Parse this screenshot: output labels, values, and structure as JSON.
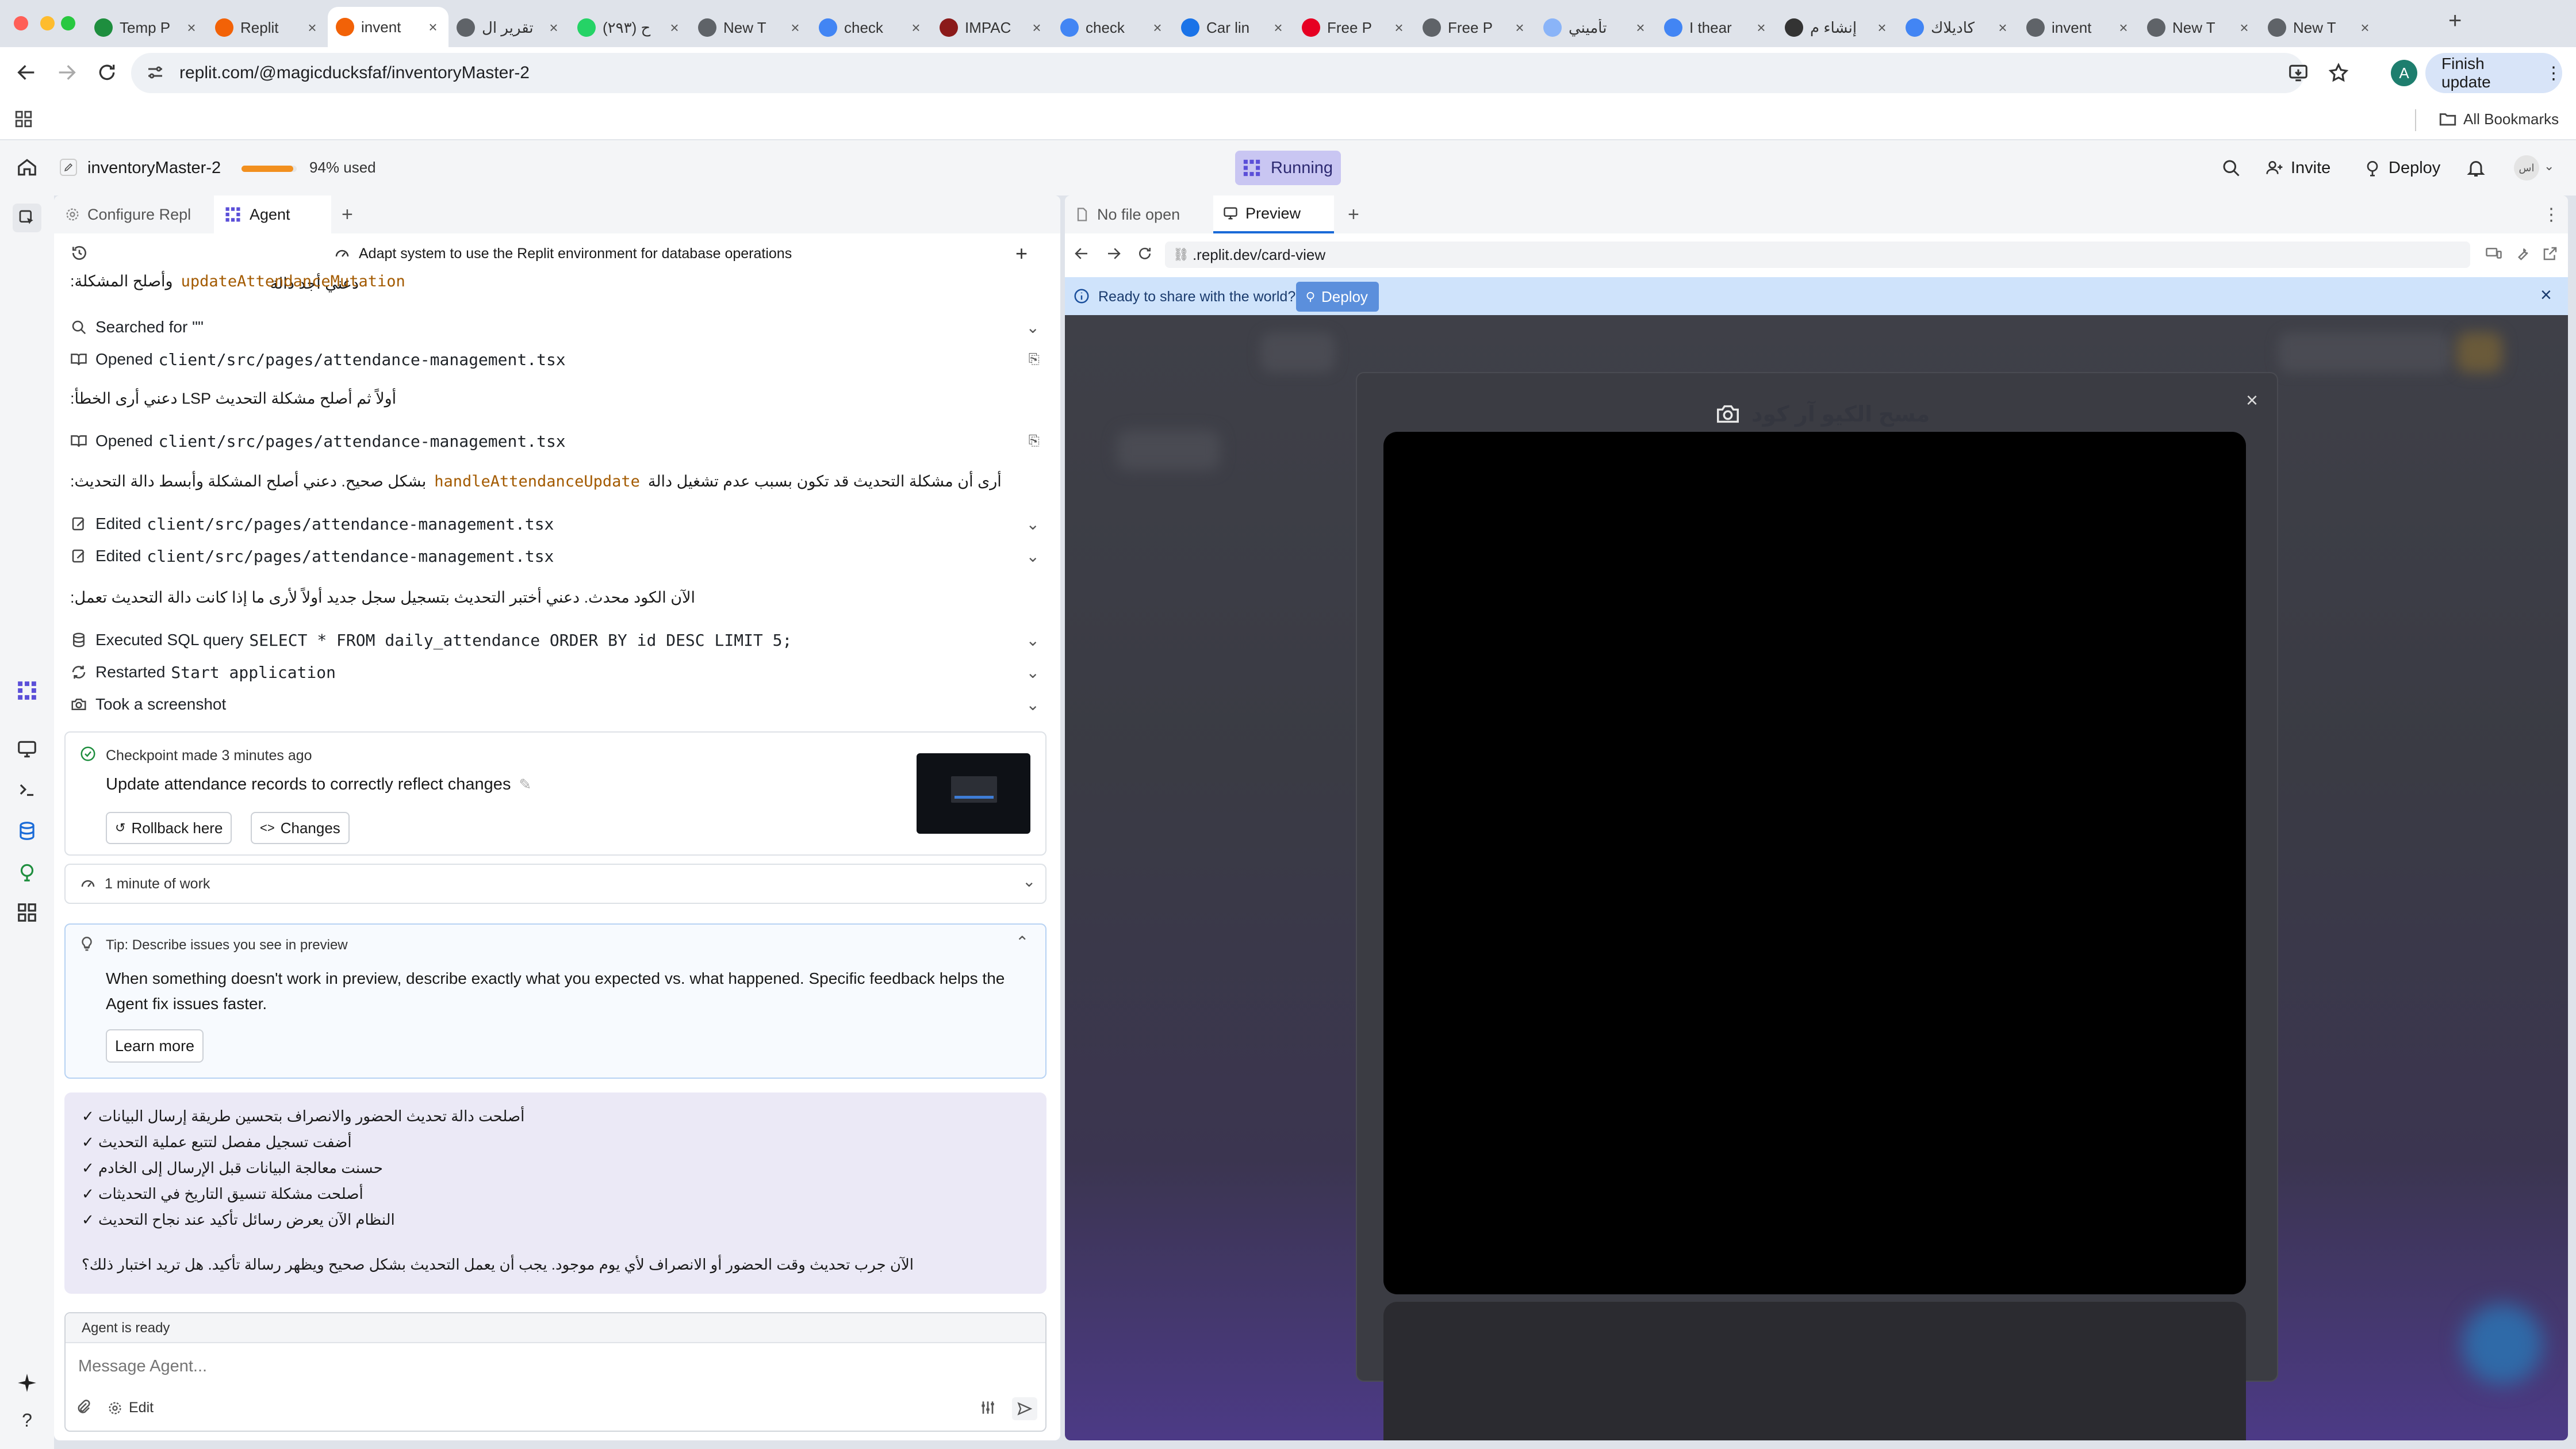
{
  "browser": {
    "tabs": [
      {
        "title": "Temp P",
        "icon": "shield-check-icon",
        "color": "#1e8e3e",
        "active": false
      },
      {
        "title": "Replit",
        "icon": "replit-icon",
        "color": "#f26207",
        "active": false
      },
      {
        "title": "invent",
        "icon": "replit-icon",
        "color": "#f26207",
        "active": true
      },
      {
        "title": "تقرير ال",
        "icon": "globe-icon",
        "color": "#5f6368",
        "active": false
      },
      {
        "title": "(٢٩٣) ح",
        "icon": "whatsapp-icon",
        "color": "#25d366",
        "active": false
      },
      {
        "title": "New T",
        "icon": "globe-icon",
        "color": "#5f6368",
        "active": false
      },
      {
        "title": "check",
        "icon": "google-icon",
        "color": "#4285f4",
        "active": false
      },
      {
        "title": "IMPAC",
        "icon": "impact-icon",
        "color": "#8b1a1a",
        "active": false
      },
      {
        "title": "check",
        "icon": "google-icon",
        "color": "#4285f4",
        "active": false
      },
      {
        "title": "Car lin",
        "icon": "car-icon",
        "color": "#1a73e8",
        "active": false
      },
      {
        "title": "Free P",
        "icon": "pinterest-icon",
        "color": "#e60023",
        "active": false
      },
      {
        "title": "Free P",
        "icon": "globe-icon",
        "color": "#5f6368",
        "active": false
      },
      {
        "title": "تأميني",
        "icon": "loading-icon",
        "color": "#8ab4f8",
        "active": false
      },
      {
        "title": "I thear",
        "icon": "google-icon",
        "color": "#4285f4",
        "active": false
      },
      {
        "title": "إنشاء م",
        "icon": "openai-icon",
        "color": "#333333",
        "active": false
      },
      {
        "title": "كاديلاك",
        "icon": "google-icon",
        "color": "#4285f4",
        "active": false
      },
      {
        "title": "invent",
        "icon": "globe-icon",
        "color": "#5f6368",
        "active": false
      },
      {
        "title": "New T",
        "icon": "globe-icon",
        "color": "#5f6368",
        "active": false
      },
      {
        "title": "New T",
        "icon": "globe-icon",
        "color": "#5f6368",
        "active": false
      }
    ],
    "url": "replit.com/@magicducksfaf/inventoryMaster-2",
    "profile_initial": "A",
    "finish_update": "Finish update",
    "all_bookmarks": "All Bookmarks"
  },
  "header": {
    "project_name": "inventoryMaster-2",
    "usage_label": "94% used",
    "usage_fraction": 0.94,
    "status": "Running",
    "invite": "Invite",
    "deploy": "Deploy",
    "avatar_text": "اس"
  },
  "left_tabs": {
    "configure": "Configure Repl",
    "agent": "Agent"
  },
  "agent": {
    "header_title": "Adapt system to use the Replit environment for database operations",
    "messages": {
      "m1_text": "دعني أجد دالة",
      "m1_code": "updateAttendanceMutation",
      "m1_text2": "وأصلح المشكلة:",
      "searched": "Searched for \"\"",
      "opened1_label": "Opened",
      "opened1_file": "client/src/pages/attendance-management.tsx",
      "m2": "أولاً ثم أصلح مشكلة التحديث LSP دعني أرى الخطأ:",
      "opened2_label": "Opened",
      "opened2_file": "client/src/pages/attendance-management.tsx",
      "m3_pre": "أرى أن مشكلة التحديث قد تكون بسبب عدم تشغيل دالة",
      "m3_code": "handleAttendanceUpdate",
      "m3_post": "بشكل صحيح. دعني أصلح المشكلة وأبسط دالة التحديث:",
      "edited1_label": "Edited",
      "edited1_file": "client/src/pages/attendance-management.tsx",
      "edited2_label": "Edited",
      "edited2_file": "client/src/pages/attendance-management.tsx",
      "m4": "الآن الكود محدث. دعني أختبر التحديث بتسجيل سجل جديد أولاً لأرى ما إذا كانت دالة التحديث تعمل:",
      "sql_label": "Executed SQL query",
      "sql_query": "SELECT * FROM daily_attendance ORDER BY id DESC LIMIT 5;",
      "restart_label": "Restarted",
      "restart_target": "Start application",
      "screenshot_label": "Took a screenshot"
    },
    "checkpoint": {
      "title": "Checkpoint made 3 minutes ago",
      "description": "Update attendance records to correctly reflect changes",
      "rollback": "Rollback here",
      "changes": "Changes"
    },
    "work": "1 minute of work",
    "tip": {
      "title": "Tip: Describe issues you see in preview",
      "body_line1": "When something doesn't work in preview, describe exactly what you expected vs. what happened. Specific feedback helps the",
      "body_line2": "Agent fix issues faster.",
      "learn_more": "Learn more"
    },
    "summary_items": [
      "أصلحت دالة تحديث الحضور والانصراف بتحسين طريقة إرسال البيانات ✓",
      "أضفت تسجيل مفصل لتتبع عملية التحديث ✓",
      "حسنت معالجة البيانات قبل الإرسال إلى الخادم ✓",
      "أصلحت مشكلة تنسيق التاريخ في التحديثات ✓",
      "النظام الآن يعرض رسائل تأكيد عند نجاح التحديث ✓"
    ],
    "summary_question": "الآن جرب تحديث وقت الحضور أو الانصراف لأي يوم موجود. يجب أن يعمل التحديث بشكل صحيح ويظهر رسالة تأكيد. هل تريد اختبار ذلك؟",
    "status": "Agent is ready",
    "input_placeholder": "Message Agent...",
    "edit_label": "Edit"
  },
  "right_tabs": {
    "no_file": "No file open",
    "preview": "Preview"
  },
  "preview": {
    "url": ".replit.dev/card-view",
    "share_text": "Ready to share with the world?",
    "deploy_btn": "Deploy",
    "modal_title": "مسح الكيو آر كود"
  }
}
